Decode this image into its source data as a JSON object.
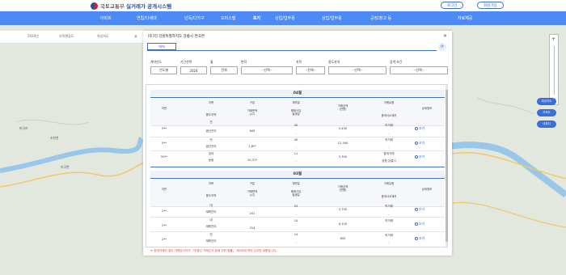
{
  "header": {
    "logo_text": "국토교통부",
    "logo_sub": "실거래가 공개시스템",
    "btn_login": "로그인",
    "btn_signup": "회원가입"
  },
  "nav": {
    "items": [
      "아파트",
      "연립/다세대",
      "단독/다가구",
      "오피스텔",
      "토지",
      "상업/업무용",
      "상업/업무용",
      "공장/창고 등"
    ],
    "right": "자료제공"
  },
  "map": {
    "tabs": [
      "2024년",
      "지적편집도",
      "위성지도"
    ],
    "side_buttons": [
      "위성지도",
      "지적도",
      "내위치"
    ],
    "labels": [
      "미곡리",
      "조천천",
      "미곡면"
    ]
  },
  "panel": {
    "title": "[토지] 강원특별자치도 강릉시 연곡면",
    "tab": "매매",
    "filters": {
      "labels": [
        "계약년도",
        "기간선택",
        "월",
        "면적",
        "지목",
        "용도지역",
        "검색 조건"
      ],
      "values": [
        "년도별",
        "2024",
        "전체",
        "--선택--",
        "--전체--",
        "--선택--",
        "--선택--"
      ]
    }
  },
  "table": {
    "header": {
      "col_no": "지번",
      "col_category": "지목",
      "col_zone": "용도지역",
      "col_type": "구분",
      "col_area": "거래면적\n(㎡)",
      "col_month": "계약월",
      "col_day": "계약일",
      "col_cancel": "해제사유\n발생일",
      "col_price": "거래금액\n(만원)",
      "col_deal": "거래유형",
      "col_agent": "중개사소재지",
      "col_detail": "상세정보"
    },
    "sections": [
      {
        "year": "04월",
        "rows": [
          {
            "no": "5**",
            "category": "전",
            "zone": "생산관리",
            "area": "645",
            "day": "30",
            "cancel": "-",
            "price": "5,430",
            "deal": "직거래",
            "agent": "-",
            "view": "보기"
          },
          {
            "no": "5**",
            "category": "전",
            "zone": "생산관리",
            "area": "1,8**",
            "day": "30",
            "cancel": "-",
            "price": "12,300",
            "deal": "직거래",
            "agent": "-",
            "view": "보기"
          },
          {
            "no": "50**",
            "category": "임야",
            "zone": "농림",
            "area": "10,37*",
            "day": "11",
            "cancel": "-",
            "price": "5,300",
            "deal": "중개거래",
            "agent": "강원 강릉시",
            "view": "보기"
          }
        ]
      },
      {
        "year": "03월",
        "rows": [
          {
            "no": "2**",
            "category": "대",
            "zone": "계획관리",
            "area": "241",
            "day": "25",
            "cancel": "-",
            "price": "2,700",
            "deal": "직거래",
            "agent": "-",
            "view": "보기"
          },
          {
            "no": "2**",
            "category": "대",
            "zone": "계획관리",
            "area": "314",
            "day": "14",
            "cancel": "-",
            "price": "6,100",
            "deal": "직거래",
            "agent": "-",
            "view": "보기"
          },
          {
            "no": "2**",
            "category": "전",
            "zone": "계획관리",
            "area": "-",
            "day": "14",
            "cancel": "-",
            "price": "600",
            "deal": "직거래",
            "agent": "-",
            "view": "보기"
          }
        ]
      }
    ]
  },
  "footnote": "※ 중개거래의 경우 거래당사자가 「부동산 거래신고 등에 관한 법률」 제3조에 따라 신고한 내용입니다.",
  "colors": {
    "accent": "#4c8bf5",
    "link": "#3b6fd6",
    "red": "#e53935"
  }
}
